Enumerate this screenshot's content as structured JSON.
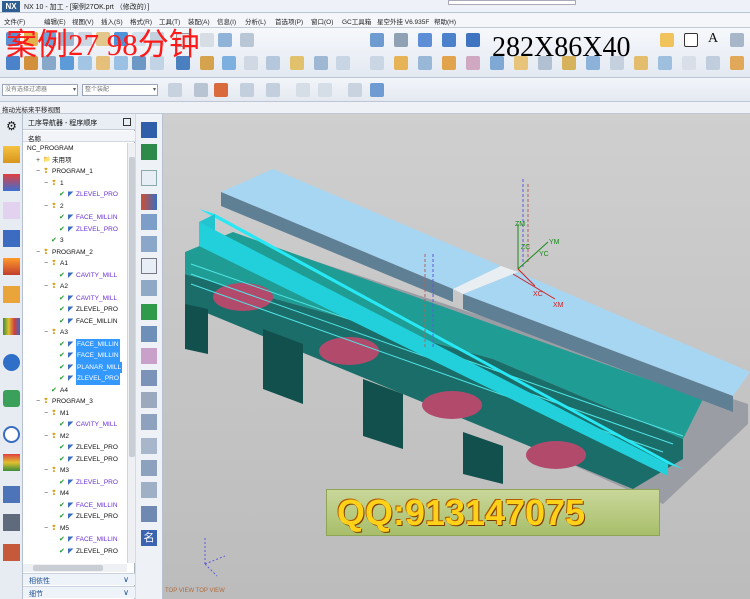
{
  "window": {
    "title": "NX 10 - 加工 - [案例27OK.prt （修改的）]",
    "logo": "NX"
  },
  "menu": [
    "文件(F)",
    "编辑(E)",
    "视图(V)",
    "插入(S)",
    "格式(R)",
    "工具(T)",
    "装配(A)",
    "信息(I)",
    "分析(L)",
    "首选项(P)",
    "窗口(O)",
    "GC工具箱",
    "星空外挂 V6.935F",
    "帮助(H)"
  ],
  "overlay": {
    "title": "案例27    98分钟",
    "dimensions": "282X86X40"
  },
  "filters": {
    "selection": "没有选择过滤器",
    "assembly": "整个装配"
  },
  "statusline": "拖动光标来平移视图",
  "navigator": {
    "title": "工序导航器 - 程序顺序",
    "column": "名称",
    "rows": [
      {
        "label": "NC_PROGRAM",
        "level": 0,
        "type": "root"
      },
      {
        "label": "未用项",
        "level": 1,
        "type": "group",
        "exp": "+"
      },
      {
        "label": "PROGRAM_1",
        "level": 1,
        "type": "program",
        "exp": "−"
      },
      {
        "label": "1",
        "level": 2,
        "type": "program",
        "exp": "−"
      },
      {
        "label": "ZLEVEL_PRO",
        "level": 3,
        "type": "op"
      },
      {
        "label": "2",
        "level": 2,
        "type": "program",
        "exp": "−"
      },
      {
        "label": "FACE_MILLIN",
        "level": 3,
        "type": "op"
      },
      {
        "label": "ZLEVEL_PRO",
        "level": 3,
        "type": "op"
      },
      {
        "label": "3",
        "level": 2,
        "type": "done"
      },
      {
        "label": "PROGRAM_2",
        "level": 1,
        "type": "program",
        "exp": "−"
      },
      {
        "label": "A1",
        "level": 2,
        "type": "program",
        "exp": "−"
      },
      {
        "label": "CAVITY_MILL",
        "level": 3,
        "type": "op"
      },
      {
        "label": "A2",
        "level": 2,
        "type": "program",
        "exp": "−"
      },
      {
        "label": "CAVITY_MILL",
        "level": 3,
        "type": "op"
      },
      {
        "label": "ZLEVEL_PRO",
        "level": 3,
        "type": "op-dark"
      },
      {
        "label": "FACE_MILLIN",
        "level": 3,
        "type": "op-dark"
      },
      {
        "label": "A3",
        "level": 2,
        "type": "program",
        "exp": "−"
      },
      {
        "label": "FACE_MILLIN",
        "level": 3,
        "type": "op",
        "selected": true
      },
      {
        "label": "FACE_MILLIN",
        "level": 3,
        "type": "op",
        "selected": true
      },
      {
        "label": "PLANAR_MILL",
        "level": 3,
        "type": "op",
        "selected": true
      },
      {
        "label": "ZLEVEL_PRO",
        "level": 3,
        "type": "op",
        "selected": true
      },
      {
        "label": "A4",
        "level": 2,
        "type": "done"
      },
      {
        "label": "PROGRAM_3",
        "level": 1,
        "type": "program",
        "exp": "−"
      },
      {
        "label": "M1",
        "level": 2,
        "type": "program",
        "exp": "−"
      },
      {
        "label": "CAVITY_MILL",
        "level": 3,
        "type": "op"
      },
      {
        "label": "M2",
        "level": 2,
        "type": "program",
        "exp": "−"
      },
      {
        "label": "ZLEVEL_PRO",
        "level": 3,
        "type": "op-dark"
      },
      {
        "label": "ZLEVEL_PRO",
        "level": 3,
        "type": "op-dark"
      },
      {
        "label": "M3",
        "level": 2,
        "type": "program",
        "exp": "−"
      },
      {
        "label": "ZLEVEL_PRO",
        "level": 3,
        "type": "op"
      },
      {
        "label": "M4",
        "level": 2,
        "type": "program",
        "exp": "−"
      },
      {
        "label": "FACE_MILLIN",
        "level": 3,
        "type": "op"
      },
      {
        "label": "ZLEVEL_PRO",
        "level": 3,
        "type": "op-dark"
      },
      {
        "label": "M5",
        "level": 2,
        "type": "program",
        "exp": "−"
      },
      {
        "label": "FACE_MILLIN",
        "level": 3,
        "type": "op"
      },
      {
        "label": "ZLEVEL_PRO",
        "level": 3,
        "type": "op-dark"
      }
    ],
    "panels": [
      "相依性",
      "细节"
    ]
  },
  "viewport": {
    "axis_labels": [
      "ZM",
      "ZC",
      "YM",
      "YC",
      "XC",
      "XM"
    ],
    "banner": "QQ:913147075",
    "view_label": "TOP VIEW    TOP VIEW"
  },
  "colors": {
    "block_top": "#a7d6f2",
    "cyan_path": "#27e8f4",
    "teal_body": "#1f9d95",
    "pocket": "#b24a6c",
    "banner": "#b9cc7d",
    "banner_text": "#ffd21a",
    "overlay_title": "#ff1a1a"
  }
}
